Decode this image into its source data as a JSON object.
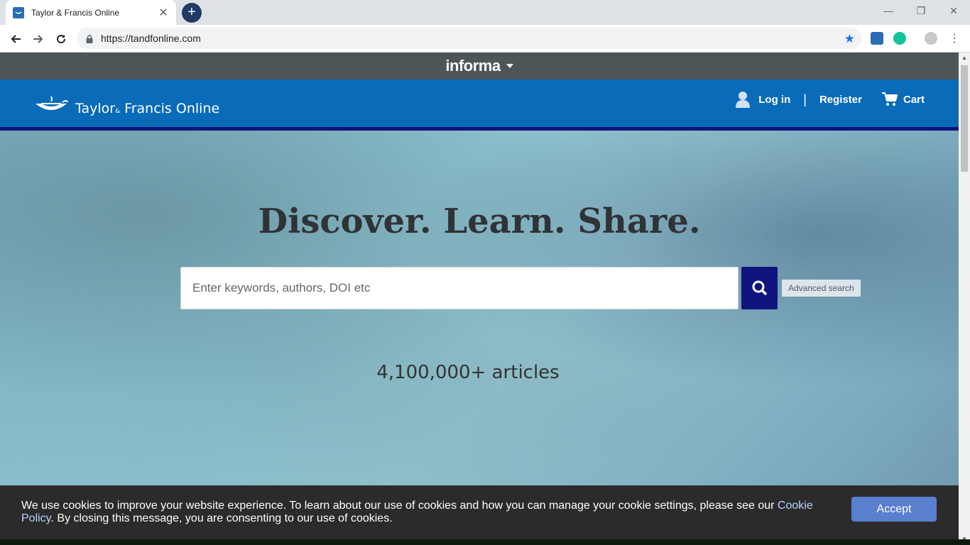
{
  "browser": {
    "tab_title": "Taylor & Francis Online",
    "url": "https://tandfonline.com",
    "colors": {
      "tabstrip": "#dee1e6",
      "newtab": "#1f3b66",
      "star": "#1a73e8"
    }
  },
  "informa": {
    "logo": "informa"
  },
  "header": {
    "brand_left": "Taylor",
    "brand_amp": "&",
    "brand_right": "Francis Online",
    "login": "Log in",
    "divider": "|",
    "register": "Register",
    "cart": "Cart",
    "colors": {
      "bar": "#0a6bb8",
      "underline": "#10147e"
    }
  },
  "hero": {
    "title": "Discover. Learn. Share.",
    "search_placeholder": "Enter keywords, authors, DOI etc",
    "advanced_search": "Advanced search",
    "articles": "4,100,000+ articles"
  },
  "cookie": {
    "text_before": "We use cookies to improve your website experience. To learn about our use of cookies and how you can manage your cookie settings, please see our ",
    "link": "Cookie Policy",
    "text_after": ". By closing this message, you are consenting to our use of cookies.",
    "accept": "Accept",
    "colors": {
      "banner": "#2b2b2b",
      "button": "#5b7fcf",
      "link": "#b9d3ff"
    }
  }
}
